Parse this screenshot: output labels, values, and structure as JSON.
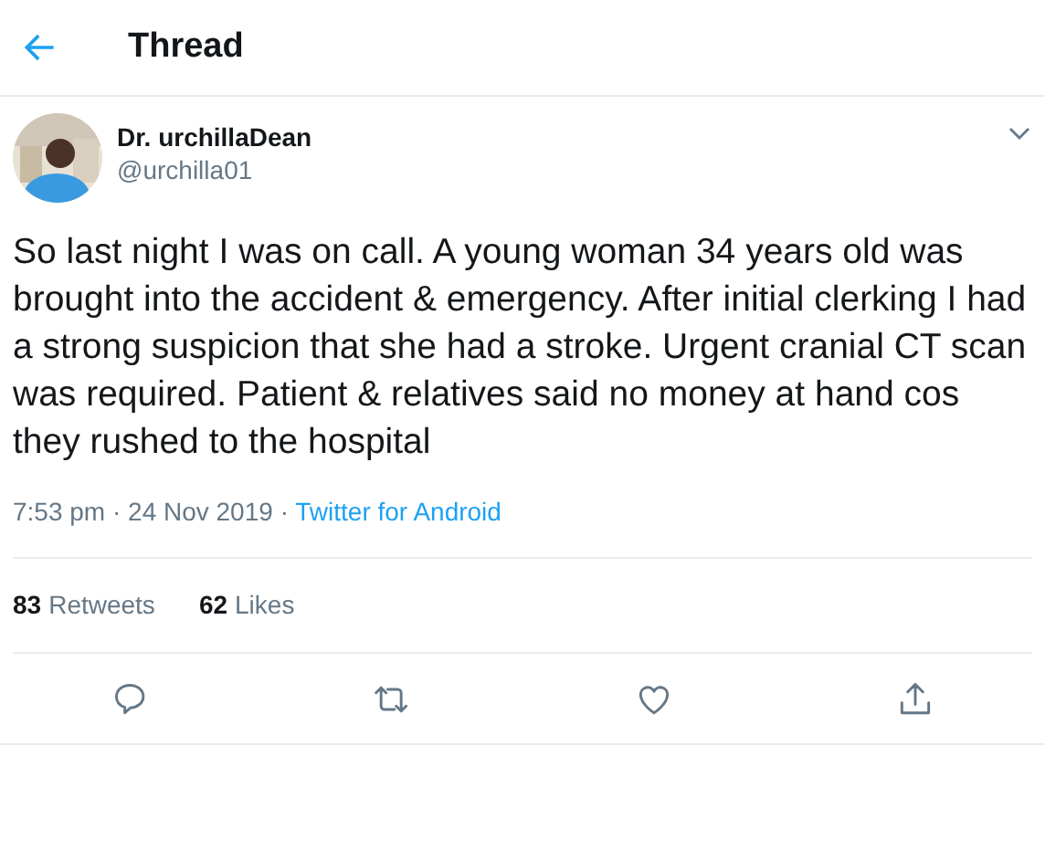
{
  "header": {
    "title": "Thread"
  },
  "tweet": {
    "name": "Dr. urchillaDean",
    "handle": "@urchilla01",
    "text": "So last night I was on call. A young woman 34 years old was brought into the accident & emergency. After initial clerking I had a strong suspicion that she had a stroke. Urgent cranial CT scan was required. Patient & relatives said no money at hand cos they rushed to the hospital",
    "time": "7:53 pm · 24 Nov 2019",
    "separator": "·",
    "source": "Twitter for Android",
    "stats": [
      {
        "count": "83",
        "label": "Retweets"
      },
      {
        "count": "62",
        "label": "Likes"
      }
    ],
    "actions": [
      {
        "kind": "reply"
      },
      {
        "kind": "retweet"
      },
      {
        "kind": "like"
      },
      {
        "kind": "share"
      }
    ]
  }
}
